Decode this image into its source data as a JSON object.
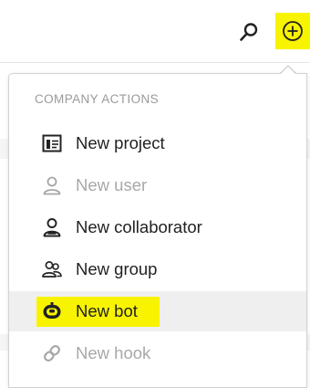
{
  "menu": {
    "heading": "COMPANY ACTIONS",
    "items": [
      {
        "label": "New project",
        "icon": "project-icon",
        "disabled": false
      },
      {
        "label": "New user",
        "icon": "user-icon",
        "disabled": true
      },
      {
        "label": "New collaborator",
        "icon": "collaborator-icon",
        "disabled": false
      },
      {
        "label": "New group",
        "icon": "group-icon",
        "disabled": false
      },
      {
        "label": "New bot",
        "icon": "bot-icon",
        "disabled": false,
        "highlighted": true
      },
      {
        "label": "New hook",
        "icon": "link-icon",
        "disabled": true
      }
    ]
  },
  "colors": {
    "highlight": "#f8f400",
    "text": "#222222",
    "disabled_text": "#a8a8a8",
    "heading": "#9a9a9a",
    "hover_bg": "#efefef"
  }
}
